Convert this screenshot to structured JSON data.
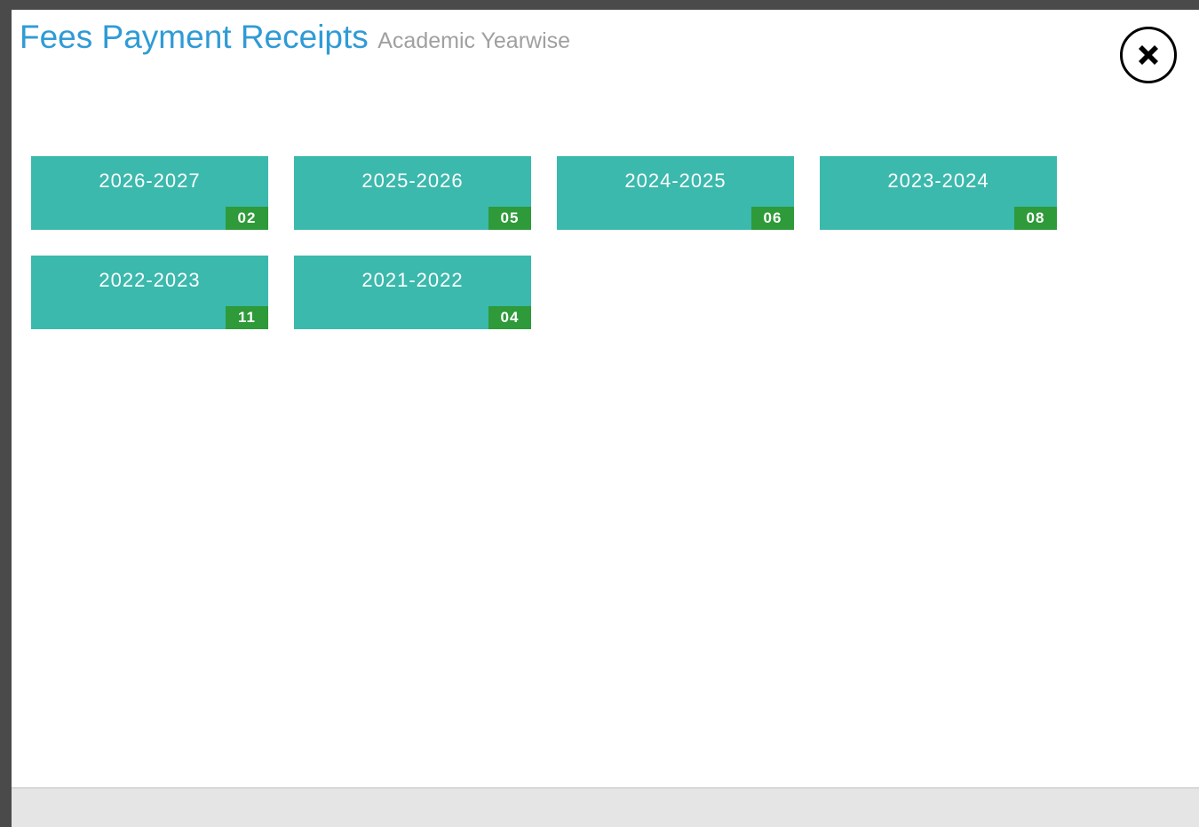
{
  "header": {
    "title": "Fees Payment Receipts",
    "subtitle": "Academic Yearwise"
  },
  "close_button": {
    "icon": "close-x-icon"
  },
  "years": [
    {
      "label": "2026-2027",
      "count": "02"
    },
    {
      "label": "2025-2026",
      "count": "05"
    },
    {
      "label": "2024-2025",
      "count": "06"
    },
    {
      "label": "2023-2024",
      "count": "08"
    },
    {
      "label": "2022-2023",
      "count": "11"
    },
    {
      "label": "2021-2022",
      "count": "04"
    }
  ],
  "colors": {
    "title": "#2f9bd6",
    "tile": "#3bb9ad",
    "badge": "#2e9a3a"
  }
}
